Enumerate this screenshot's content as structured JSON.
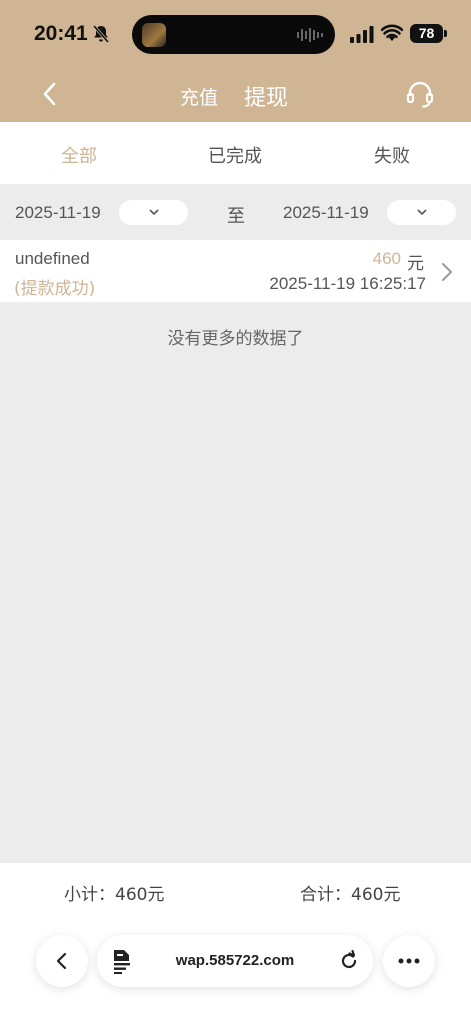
{
  "status_bar": {
    "time": "20:41",
    "battery": "78"
  },
  "header": {
    "tab_recharge": "充值",
    "tab_withdraw": "提现"
  },
  "filter_tabs": [
    {
      "label": "全部",
      "active": true
    },
    {
      "label": "已完成",
      "active": false
    },
    {
      "label": "失败",
      "active": false
    }
  ],
  "date_range": {
    "start": "2025-11-19",
    "separator": "至",
    "end": "2025-11-19"
  },
  "records": [
    {
      "name": "undefined",
      "status": "(提款成功)",
      "amount": "460",
      "unit": "元",
      "time": "2025-11-19 16:25:17"
    }
  ],
  "no_more_text": "没有更多的数据了",
  "totals": {
    "subtotal": "小计：460元",
    "total": "合计：460元"
  },
  "browser": {
    "url": "wap.585722.com"
  },
  "colors": {
    "accent": "#cfb593",
    "background": "#ececec"
  }
}
